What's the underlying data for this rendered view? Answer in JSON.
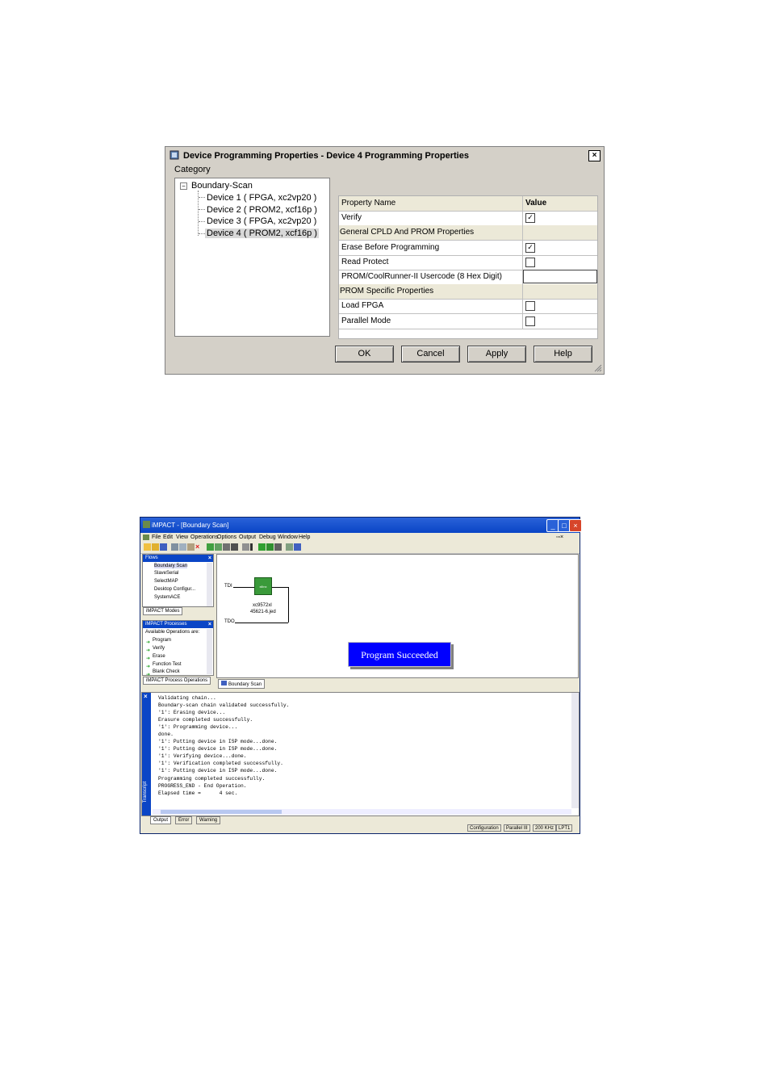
{
  "dialog": {
    "title": "Device Programming Properties - Device 4 Programming Properties",
    "close": "×",
    "category_label": "Category",
    "tree": {
      "root": "Boundary-Scan",
      "items": [
        "Device 1 ( FPGA, xc2vp20 )",
        "Device 2 ( PROM2, xcf16p )",
        "Device 3 ( FPGA, xc2vp20 )",
        "Device 4 ( PROM2, xcf16p )"
      ]
    },
    "grid": {
      "col_name": "Property Name",
      "col_value": "Value",
      "rows": [
        {
          "name": "Verify",
          "type": "check",
          "checked": true
        },
        {
          "name": "General CPLD And PROM Properties",
          "type": "group"
        },
        {
          "name": "Erase Before Programming",
          "type": "check",
          "checked": true
        },
        {
          "name": "Read Protect",
          "type": "check",
          "checked": false
        },
        {
          "name": "PROM/CoolRunner-II Usercode (8 Hex Digit)",
          "type": "text",
          "value": ""
        },
        {
          "name": "PROM Specific Properties",
          "type": "group"
        },
        {
          "name": "Load FPGA",
          "type": "check",
          "checked": false
        },
        {
          "name": "Parallel Mode",
          "type": "check",
          "checked": false
        }
      ]
    },
    "buttons": {
      "ok": "OK",
      "cancel": "Cancel",
      "apply": "Apply",
      "help": "Help"
    }
  },
  "impact": {
    "title": "iMPACT - [Boundary Scan]",
    "menu": [
      "File",
      "Edit",
      "View",
      "Operations",
      "Options",
      "Output",
      "Debug",
      "Window",
      "Help"
    ],
    "flows": {
      "header": "Flows",
      "items": [
        "Boundary Scan",
        "SlaveSerial",
        "SelectMAP",
        "Desktop Configur...",
        "SystemACE"
      ],
      "tab": "iMPACT Modes"
    },
    "processes": {
      "header": "iMPACT Processes",
      "caption": "Available Operations are:",
      "items": [
        "Program",
        "Verify",
        "Erase",
        "Function Test",
        "Blank Check"
      ],
      "tab": "iMPACT Process Operations"
    },
    "canvas": {
      "tdi": "TDI",
      "tdo": "TDO",
      "chip_label": "xilinx",
      "device_line1": "xc9572xl",
      "device_line2": "45621-6.jed",
      "message": "Program Succeeded",
      "tab": "Boundary Scan"
    },
    "console": {
      "lines": [
        "Validating chain...",
        "Boundary-scan chain validated successfully.",
        "'1': Erasing device...",
        "Erasure completed successfully.",
        "'1': Programming device...",
        "done.",
        "'1': Putting device in ISP mode...done.",
        "'1': Putting device in ISP mode...done.",
        "'1': Verifying device...done.",
        "'1': Verification completed successfully.",
        "'1': Putting device in ISP mode...done.",
        "Programming completed successfully.",
        "PROGRESS_END - End Operation.",
        "Elapsed time =      4 sec."
      ],
      "tabs": [
        "Output",
        "Error",
        "Warning"
      ],
      "side_label": "Transcript"
    },
    "status": [
      "Configuration",
      "Parallel III",
      "200 KHz",
      "LPT1"
    ]
  }
}
